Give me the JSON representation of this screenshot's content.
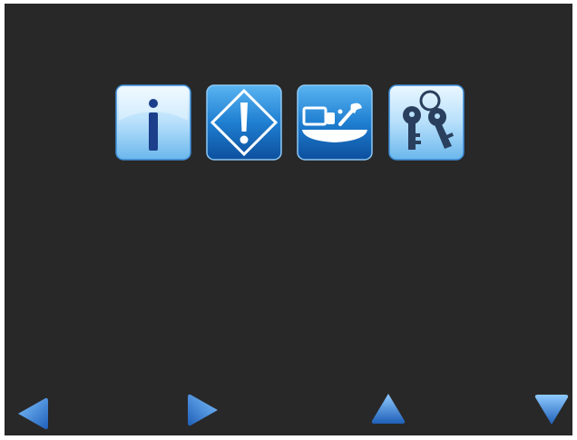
{
  "screen": {
    "background": "#282828",
    "menu": [
      {
        "id": "info",
        "icon": "info-icon",
        "tint": "light"
      },
      {
        "id": "warning",
        "icon": "warning-diamond-icon",
        "tint": "dark"
      },
      {
        "id": "service",
        "icon": "machine-service-icon",
        "tint": "dark"
      },
      {
        "id": "keys",
        "icon": "keys-icon",
        "tint": "light"
      }
    ],
    "nav": [
      {
        "id": "left",
        "icon": "arrow-left-icon"
      },
      {
        "id": "right",
        "icon": "arrow-right-icon"
      },
      {
        "id": "up",
        "icon": "arrow-up-icon"
      },
      {
        "id": "down",
        "icon": "arrow-down-icon"
      }
    ],
    "colors": {
      "accent_dark": "#1a6fbf",
      "accent_light": "#cfeaff",
      "nav_arrow": "#3f8fe0"
    }
  }
}
